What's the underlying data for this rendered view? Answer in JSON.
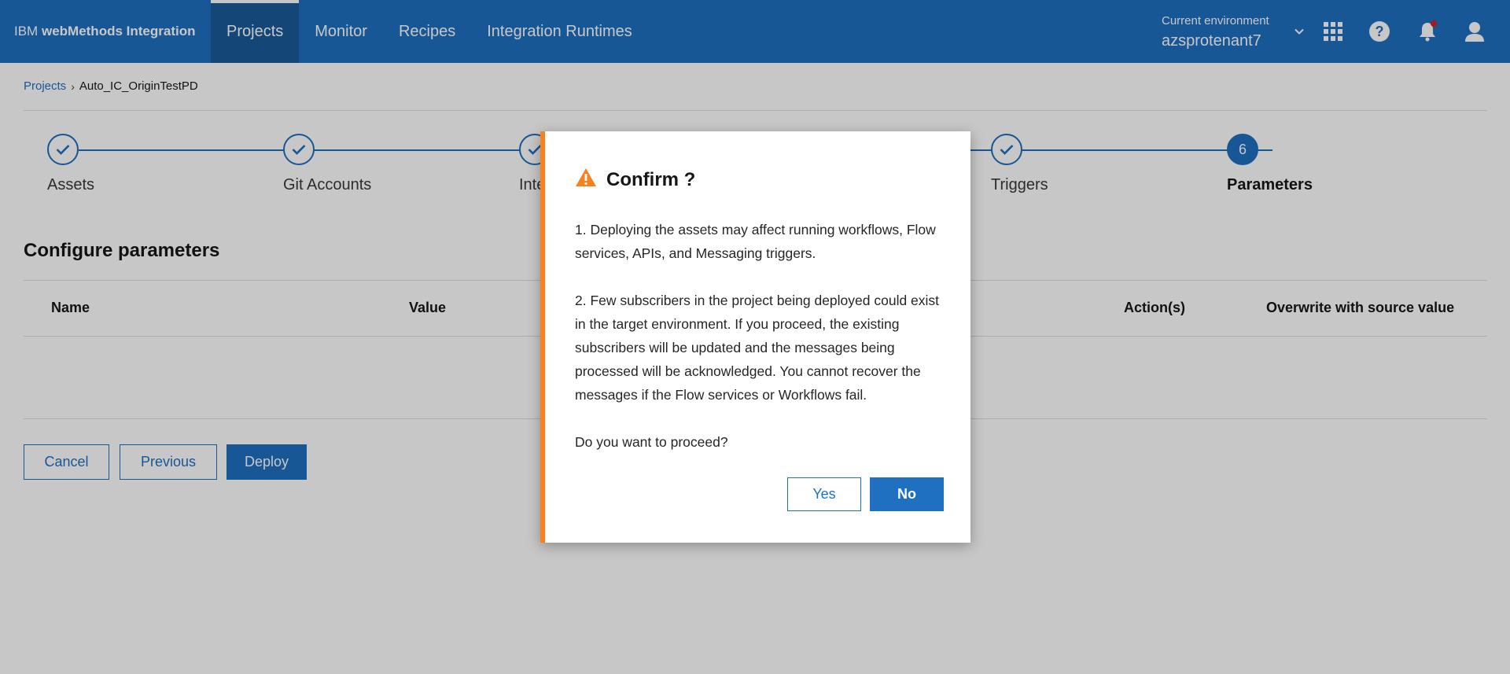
{
  "header": {
    "brand_prefix": "IBM",
    "brand_name": "webMethods Integration",
    "nav": [
      "Projects",
      "Monitor",
      "Recipes",
      "Integration Runtimes"
    ],
    "env_label": "Current environment",
    "env_value": "azsprotenant7"
  },
  "breadcrumb": {
    "root": "Projects",
    "current": "Auto_IC_OriginTestPD"
  },
  "steps": [
    {
      "label": "Assets",
      "status": "complete"
    },
    {
      "label": "Git Accounts",
      "status": "complete"
    },
    {
      "label": "Inte",
      "status": "complete"
    },
    {
      "label": "Triggers",
      "status": "complete"
    },
    {
      "label": "Parameters",
      "status": "current",
      "number": "6"
    }
  ],
  "section": {
    "title": "Configure parameters",
    "columns": [
      "Name",
      "Value",
      "Action(s)",
      "Overwrite with source value"
    ]
  },
  "actions": {
    "cancel": "Cancel",
    "previous": "Previous",
    "deploy": "Deploy"
  },
  "dialog": {
    "title": "Confirm ?",
    "paragraphs": [
      "1. Deploying the assets may affect running workflows, Flow services, APIs, and Messaging triggers.",
      "2. Few subscribers in the project being deployed could exist in the target environment. If you proceed, the existing subscribers will be updated and the messages being processed will be acknowledged. You cannot recover the messages if the Flow services or Workflows fail.",
      "Do you want to proceed?"
    ],
    "yes": "Yes",
    "no": "No"
  },
  "colors": {
    "primary": "#1f70c1",
    "header": "#1f70c1",
    "warning": "#f5821f",
    "notification_dot": "#da1e28"
  }
}
